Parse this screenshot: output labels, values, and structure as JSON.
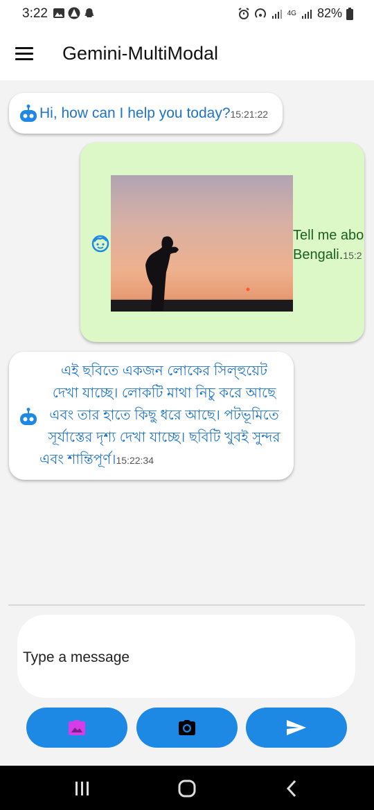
{
  "status": {
    "time": "3:22",
    "battery": "82%",
    "network": "4G"
  },
  "app": {
    "title": "Gemini-MultiModal"
  },
  "messages": [
    {
      "sender": "bot",
      "text": "Hi, how can I help you today?",
      "time": "15:21:22"
    },
    {
      "sender": "user",
      "text": "Tell me abo",
      "text2": "Bengali.",
      "time": "15:2"
    },
    {
      "sender": "bot",
      "lines": [
        "এই ছবিতে একজন লোকের সিল্হুয়েট",
        "দেখা যাচ্ছে। লোকটি মাথা নিচু করে আছে",
        "এবং তার হাতে কিছু ধরে আছে। পটভূমিতে",
        "সূর্যাস্তের দৃশ্য দেখা যাচ্ছে। ছবিটি খুবই সুন্দর",
        "এবং শান্তিপূর্ণ।"
      ],
      "time": "15:22:34"
    }
  ],
  "input": {
    "placeholder": "Type a message"
  },
  "icons": {
    "menu": "menu-icon",
    "bot": "robot-icon",
    "user": "face-icon",
    "gallery": "gallery-icon",
    "camera": "camera-icon",
    "send": "send-icon"
  },
  "colors": {
    "accent": "#1e88e5",
    "bot_text": "#1d73c8",
    "user_bubble": "#dcf8c6",
    "gallery_icon": "#d63de8"
  }
}
